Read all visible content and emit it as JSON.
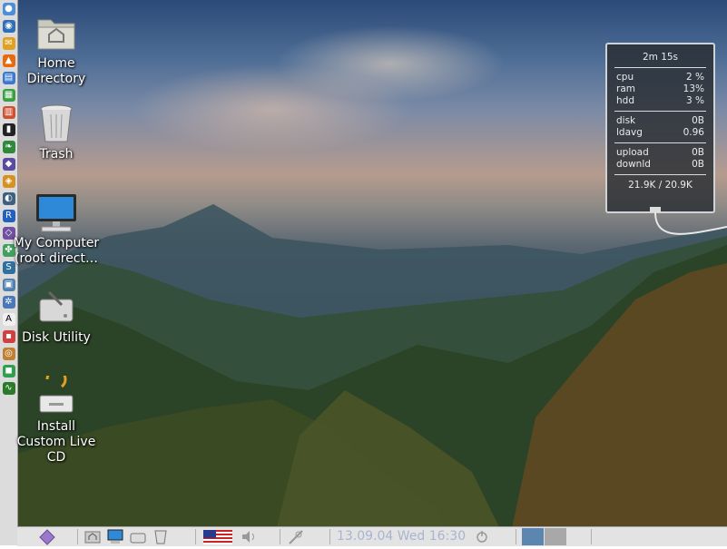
{
  "desktop": {
    "icons": [
      {
        "label": "Home Directory",
        "icon": "folder-home-icon"
      },
      {
        "label": "Trash",
        "icon": "trash-icon"
      },
      {
        "label": "My Computer (root direct…",
        "icon": "computer-icon"
      },
      {
        "label": "Disk Utility",
        "icon": "disk-utility-icon"
      },
      {
        "label": "Install Custom Live CD",
        "icon": "install-cd-icon"
      }
    ]
  },
  "sysmon": {
    "uptime": "2m 15s",
    "cpu_label": "cpu",
    "cpu_value": "2 %",
    "ram_label": "ram",
    "ram_value": "13%",
    "hdd_label": "hdd",
    "hdd_value": "3 %",
    "disk_label": "disk",
    "disk_value": "0B",
    "ldavg_label": "ldavg",
    "ldavg_value": "0.96",
    "upload_label": "upload",
    "upload_value": "0B",
    "downld_label": "downld",
    "downld_value": "0B",
    "traffic": "21.9K / 20.9K"
  },
  "panel": {
    "clock": "13.09.04 Wed 16:30",
    "icons": [
      "menu-icon",
      "home-icon",
      "computer-icon",
      "disk-icon",
      "trash-icon",
      "us-flag-icon",
      "volume-icon",
      "network-icon",
      "power-icon"
    ]
  },
  "colors": {
    "panel_bg": "#e3e3e3",
    "clock_text": "#a8b4d0",
    "workspace_active": "#5a86b0",
    "workspace_inactive": "#a8a8a8"
  }
}
